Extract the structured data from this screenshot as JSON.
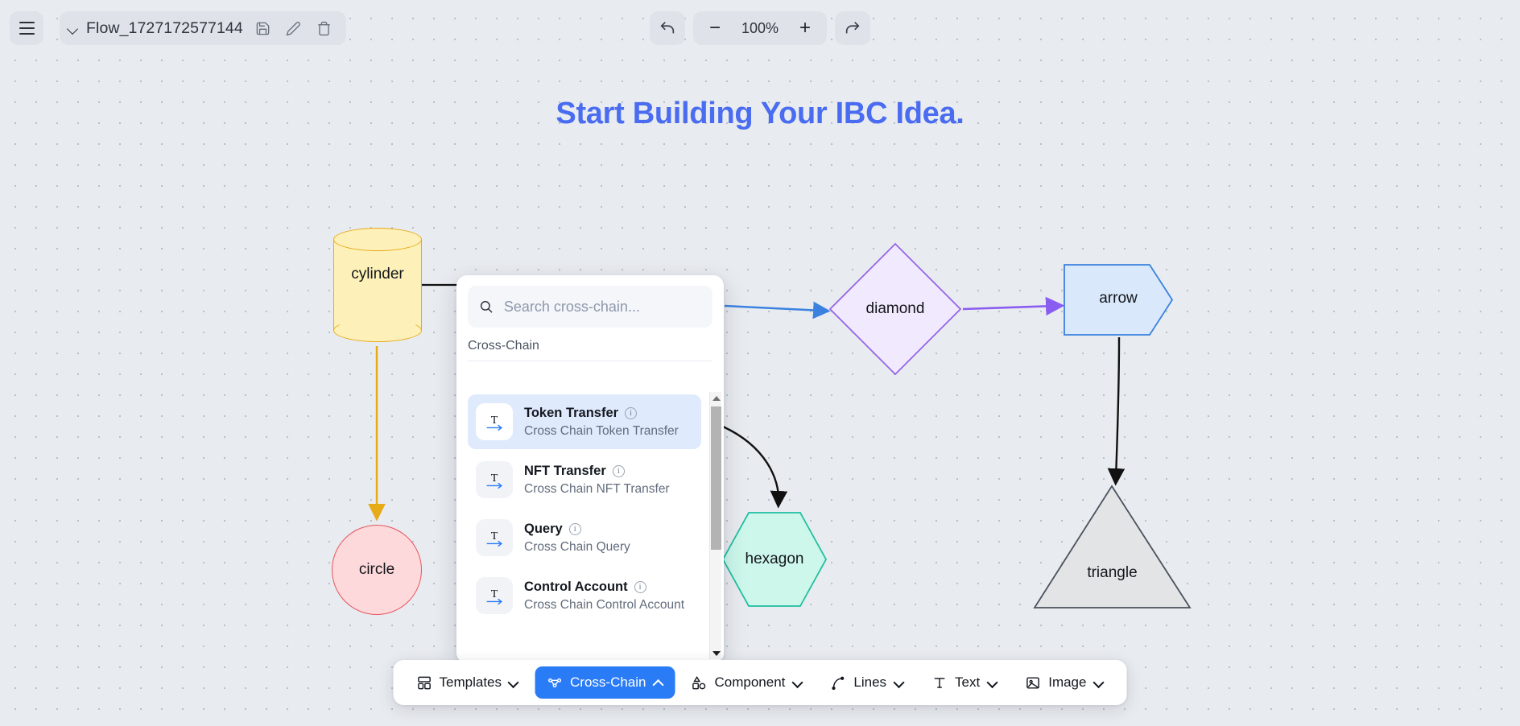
{
  "topbar": {
    "menu_icon": "hamburger-menu-icon",
    "file_chevron_icon": "chevron-down-icon",
    "file_name": "Flow_1727172577144",
    "save_icon": "save-disk-icon",
    "edit_icon": "pencil-edit-icon",
    "delete_icon": "trash-delete-icon",
    "undo_icon": "undo-arrow-icon",
    "redo_icon": "redo-arrow-icon",
    "zoom_out_label": "−",
    "zoom_value": "100%",
    "zoom_in_label": "+"
  },
  "canvas": {
    "title": "Start Building Your IBC Idea.",
    "title_color": "#4a6cf0",
    "background": "#e8ebef",
    "nodes": [
      {
        "id": "cylinder",
        "label": "cylinder",
        "fill": "#fdf0b8",
        "stroke": "#e8ab18"
      },
      {
        "id": "circle",
        "label": "circle",
        "fill": "#fdd9db",
        "stroke": "#e7565f"
      },
      {
        "id": "diamond",
        "label": "diamond",
        "fill": "#f1e9fd",
        "stroke": "#9566e8"
      },
      {
        "id": "arrow",
        "label": "arrow",
        "fill": "#d9e8fb",
        "stroke": "#3b82e0"
      },
      {
        "id": "hexagon",
        "label": "hexagon",
        "fill": "#ccf7ea",
        "stroke": "#1fbfa0"
      },
      {
        "id": "triangle",
        "label": "triangle",
        "fill": "#e3e4e6",
        "stroke": "#4a525e"
      }
    ],
    "edges": [
      {
        "from": "cylinder",
        "to": "circle",
        "color": "#e8ab18"
      },
      {
        "from": "cylinder",
        "to": "diamond",
        "color": "#3b82e0"
      },
      {
        "from": "diamond",
        "to": "arrow",
        "color": "#8a5cf0"
      },
      {
        "from": "arrow",
        "to": "triangle",
        "color": "#111111"
      },
      {
        "from": "diamond",
        "to": "hexagon",
        "color": "#111111"
      }
    ]
  },
  "panel": {
    "search": {
      "icon": "search-icon",
      "placeholder": "Search cross-chain...",
      "value": ""
    },
    "group_title": "Cross-Chain",
    "items": [
      {
        "icon": "text-transfer-icon",
        "title": "Token Transfer",
        "info_icon": "info-icon",
        "desc": "Cross Chain Token Transfer",
        "selected": true
      },
      {
        "icon": "text-transfer-icon",
        "title": "NFT Transfer",
        "info_icon": "info-icon",
        "desc": "Cross Chain NFT Transfer",
        "selected": false
      },
      {
        "icon": "text-transfer-icon",
        "title": "Query",
        "info_icon": "info-icon",
        "desc": "Cross Chain Query",
        "selected": false
      },
      {
        "icon": "text-transfer-icon",
        "title": "Control Account",
        "info_icon": "info-icon",
        "desc": "Cross Chain Control Account",
        "selected": false
      }
    ],
    "scrollbar": {
      "up_icon": "scroll-up-arrow-icon",
      "down_icon": "scroll-down-arrow-icon"
    }
  },
  "toolbar": {
    "active_color": "#2a7bf6",
    "buttons": [
      {
        "icon": "templates-grid-icon",
        "label": "Templates",
        "chevron": "down",
        "active": false
      },
      {
        "icon": "cross-chain-nodes-icon",
        "label": "Cross-Chain",
        "chevron": "up",
        "active": true
      },
      {
        "icon": "component-shapes-icon",
        "label": "Component",
        "chevron": "down",
        "active": false
      },
      {
        "icon": "lines-curve-icon",
        "label": "Lines",
        "chevron": "down",
        "active": false
      },
      {
        "icon": "text-t-icon",
        "label": "Text",
        "chevron": "down",
        "active": false
      },
      {
        "icon": "image-picture-icon",
        "label": "Image",
        "chevron": "down",
        "active": false
      }
    ]
  }
}
